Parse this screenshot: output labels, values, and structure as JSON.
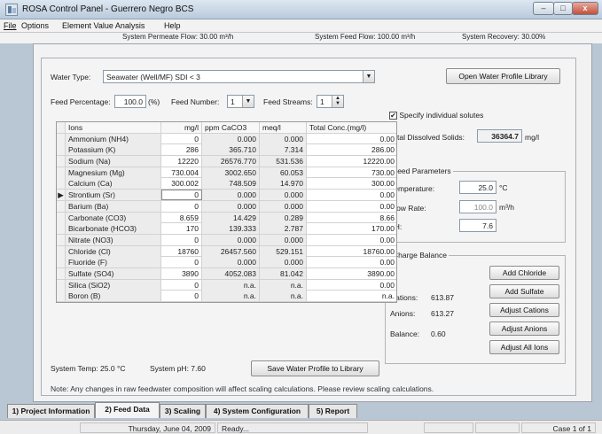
{
  "window": {
    "title": "ROSA Control Panel - Guerrero Negro BCS",
    "minimize": "–",
    "maximize": "□",
    "close": "x"
  },
  "menu": [
    "File",
    "Options",
    "Element Value Analysis",
    "Help"
  ],
  "summary": {
    "permeate_flow": "System Permeate Flow:  30.00 m³/h",
    "feed_flow": "System Feed Flow:  100.00 m³/h",
    "recovery": "System Recovery:   30.00%"
  },
  "water_type": {
    "label": "Water Type:",
    "value": "Seawater (Well/MF) SDI < 3",
    "library_button": "Open Water Profile Library"
  },
  "feed": {
    "percentage_label": "Feed Percentage:",
    "percentage_value": "100.0",
    "percentage_unit": "(%)",
    "number_label": "Feed Number:",
    "number_value": "1",
    "streams_label": "Feed Streams:",
    "streams_value": "1"
  },
  "grid": {
    "headers": [
      "Ions",
      "mg/l",
      "ppm CaCO3",
      "meq/l",
      "Total Conc.(mg/l)"
    ],
    "rows": [
      {
        "ion": "Ammonium (NH4)",
        "mgl": "0",
        "ppm": "0.000",
        "meql": "0.000",
        "total": "0.00"
      },
      {
        "ion": "Potassium (K)",
        "mgl": "286",
        "ppm": "365.710",
        "meql": "7.314",
        "total": "286.00"
      },
      {
        "ion": "Sodium (Na)",
        "mgl": "12220",
        "ppm": "26576.770",
        "meql": "531.536",
        "total": "12220.00"
      },
      {
        "ion": "Magnesium (Mg)",
        "mgl": "730.004",
        "ppm": "3002.650",
        "meql": "60.053",
        "total": "730.00"
      },
      {
        "ion": "Calcium (Ca)",
        "mgl": "300.002",
        "ppm": "748.509",
        "meql": "14.970",
        "total": "300.00"
      },
      {
        "ion": "Strontium (Sr)",
        "mgl": "0",
        "ppm": "0.000",
        "meql": "0.000",
        "total": "0.00",
        "selected": true
      },
      {
        "ion": "Barium (Ba)",
        "mgl": "0",
        "ppm": "0.000",
        "meql": "0.000",
        "total": "0.00"
      },
      {
        "ion": "Carbonate (CO3)",
        "mgl": "8.659",
        "ppm": "14.429",
        "meql": "0.289",
        "total": "8.66"
      },
      {
        "ion": "Bicarbonate (HCO3)",
        "mgl": "170",
        "ppm": "139.333",
        "meql": "2.787",
        "total": "170.00"
      },
      {
        "ion": "Nitrate (NO3)",
        "mgl": "0",
        "ppm": "0.000",
        "meql": "0.000",
        "total": "0.00"
      },
      {
        "ion": "Chloride (Cl)",
        "mgl": "18760",
        "ppm": "26457.560",
        "meql": "529.151",
        "total": "18760.00"
      },
      {
        "ion": "Fluoride (F)",
        "mgl": "0",
        "ppm": "0.000",
        "meql": "0.000",
        "total": "0.00"
      },
      {
        "ion": "Sulfate (SO4)",
        "mgl": "3890",
        "ppm": "4052.083",
        "meql": "81.042",
        "total": "3890.00"
      },
      {
        "ion": "Silica (SiO2)",
        "mgl": "0",
        "ppm": "n.a.",
        "meql": "n.a.",
        "total": "0.00"
      },
      {
        "ion": "Boron (B)",
        "mgl": "0",
        "ppm": "n.a.",
        "meql": "n.a.",
        "total": "n.a."
      }
    ],
    "row_marker": "▶"
  },
  "solutes": {
    "checkbox_label": "Specify individual solutes",
    "checked": true,
    "tds_label": "Total Dissolved Solids:",
    "tds_value": "36364.7",
    "tds_unit": "mg/l"
  },
  "feed_params": {
    "title": "Feed Parameters",
    "temp_label": "Temperature:",
    "temp_value": "25.0",
    "temp_unit": "°C",
    "flow_label": "Flow Rate:",
    "flow_value": "100.0",
    "flow_unit": "m³/h",
    "ph_label": "pH:",
    "ph_value": "7.6"
  },
  "charge": {
    "title": "Charge Balance",
    "cations_label": "Cations:",
    "cations_value": "613.87",
    "anions_label": "Anions:",
    "anions_value": "613.27",
    "balance_label": "Balance:",
    "balance_value": "0.60",
    "buttons": [
      "Add Chloride",
      "Add Sulfate",
      "Adjust Cations",
      "Adjust Anions",
      "Adjust All Ions"
    ]
  },
  "bottom": {
    "system_temp": "System Temp:  25.0  °C",
    "system_ph": "System pH:    7.60",
    "save_button": "Save Water Profile to Library",
    "note": "Note: Any changes in raw feedwater composition will affect scaling calculations. Please review scaling calculations."
  },
  "tabs": [
    "1) Project Information",
    "2) Feed Data",
    "3) Scaling",
    "4) System Configuration",
    "5) Report"
  ],
  "active_tab": 1,
  "status": {
    "date": "Thursday, June 04, 2009",
    "state": "Ready...",
    "case": "Case 1 of 1"
  }
}
